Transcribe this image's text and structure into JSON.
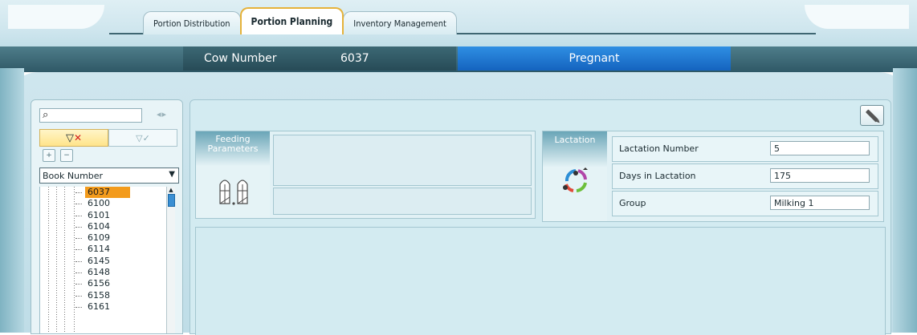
{
  "tabs": [
    {
      "label": "Portion Distribution",
      "active": false
    },
    {
      "label": "Portion Planning",
      "active": true
    },
    {
      "label": "Inventory Management",
      "active": false
    }
  ],
  "header": {
    "cow_label": "Cow Number",
    "cow_value": "6037",
    "status": "Pregnant"
  },
  "sidebar": {
    "search": {
      "value": "",
      "placeholder": ""
    },
    "select": {
      "value": "Book Number"
    },
    "tree_items": [
      "6037",
      "6100",
      "6101",
      "6104",
      "6109",
      "6114",
      "6145",
      "6148",
      "6156",
      "6158",
      "6161"
    ],
    "selected_item": "6037"
  },
  "feeding": {
    "title_line1": "Feeding",
    "title_line2": "Parameters"
  },
  "lactation": {
    "title": "Lactation",
    "rows": [
      {
        "label": "Lactation Number",
        "value": "5"
      },
      {
        "label": "Days in Lactation",
        "value": "175"
      },
      {
        "label": "Group",
        "value": "Milking 1"
      }
    ]
  },
  "colors": {
    "status_bar": "#1f78d1",
    "header_bar": "#2f5866",
    "selection": "#f39b1c",
    "active_tab_outline": "#e5b23a"
  },
  "icons": [
    "search-icon",
    "arrows-icon",
    "filter-clear-icon",
    "filter-apply-icon",
    "expand-icon",
    "collapse-icon",
    "pencil-icon",
    "silo-icon",
    "lactation-cycle-icon"
  ]
}
